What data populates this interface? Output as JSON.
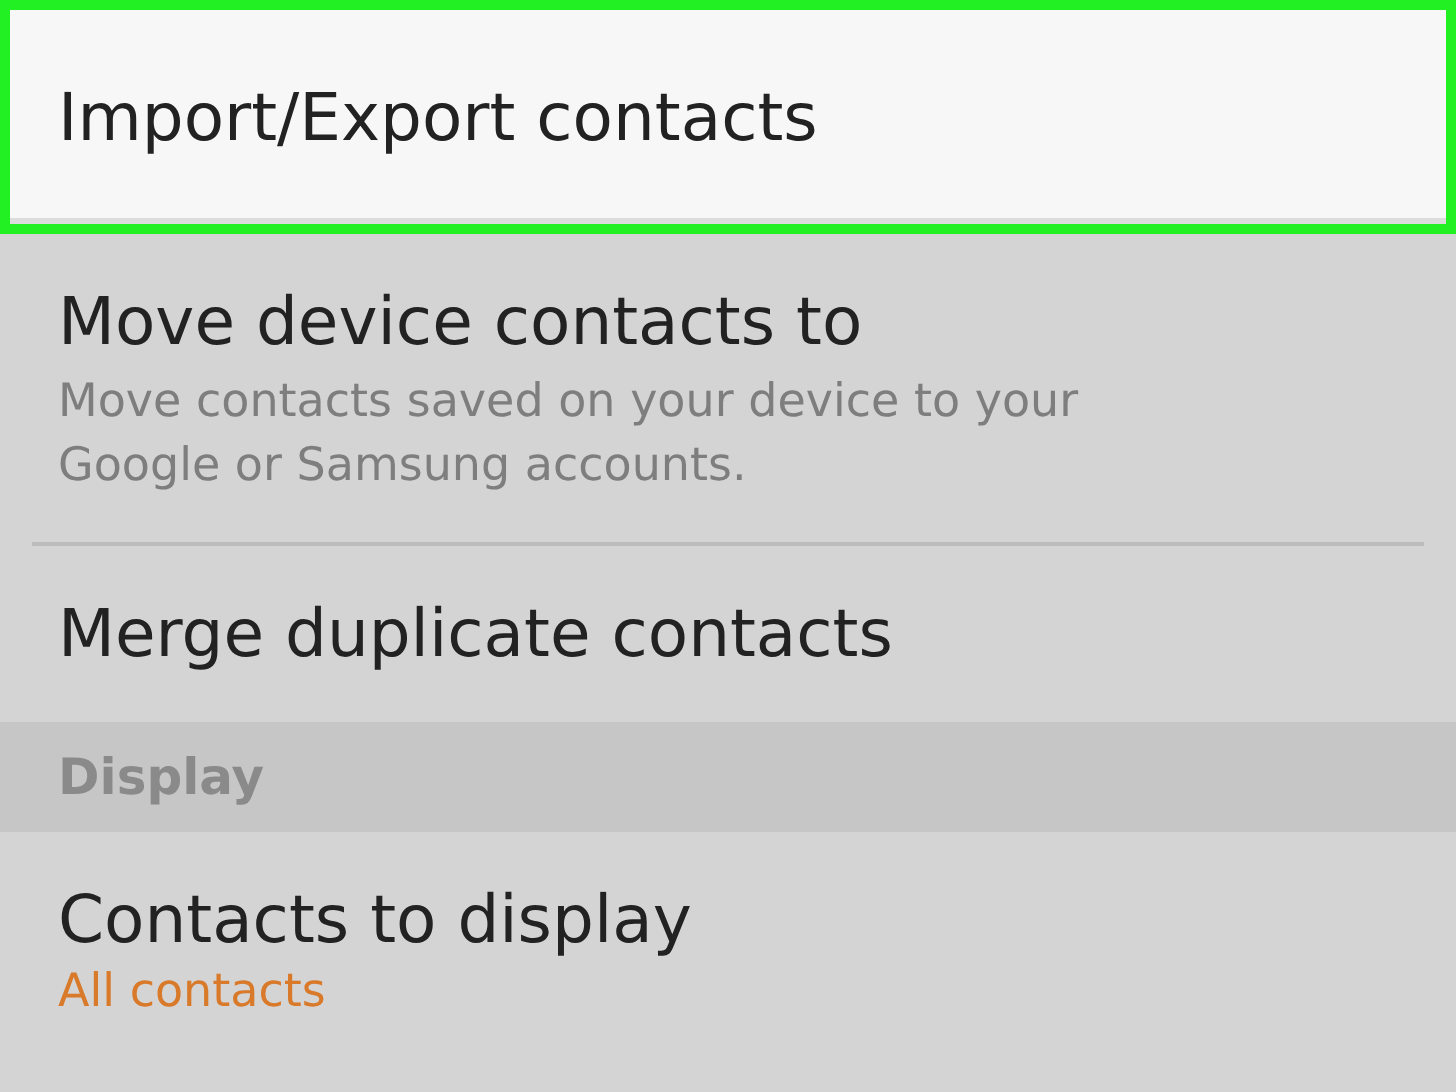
{
  "settings": [
    {
      "kind": "item",
      "title": "Import/Export contacts",
      "highlighted": true
    },
    {
      "kind": "item",
      "title": "Move device contacts to",
      "subtitle": "Move contacts saved on your device to your Google or Samsung accounts.",
      "highlighted": false,
      "divider": true
    },
    {
      "kind": "item",
      "title": "Merge duplicate contacts",
      "highlighted": false
    },
    {
      "kind": "header",
      "title": "Display"
    },
    {
      "kind": "item",
      "title": "Contacts to display",
      "value": "All contacts",
      "highlighted": false
    }
  ]
}
